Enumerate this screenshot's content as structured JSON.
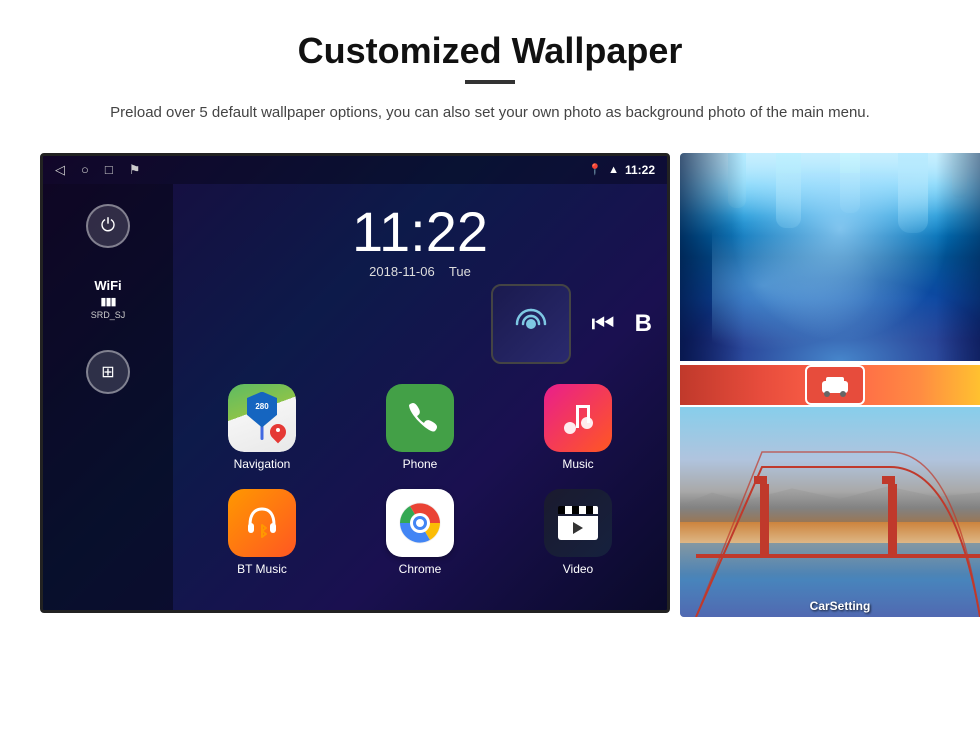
{
  "page": {
    "title": "Customized Wallpaper",
    "description": "Preload over 5 default wallpaper options, you can also set your own photo as background photo of the main menu."
  },
  "android": {
    "statusBar": {
      "time": "11:22",
      "navIcons": [
        "◁",
        "○",
        "□",
        "⚑"
      ],
      "rightIcons": [
        "📍",
        "WiFi",
        "11:22"
      ]
    },
    "clock": {
      "time": "11:22",
      "date": "2018-11-06",
      "day": "Tue"
    },
    "sidebar": {
      "powerLabel": "⏻",
      "wifi": {
        "label": "WiFi",
        "ssid": "SRD_SJ"
      },
      "appsLabel": "⊞"
    },
    "apps": [
      {
        "id": "navigation",
        "label": "Navigation",
        "icon": "navigation"
      },
      {
        "id": "phone",
        "label": "Phone",
        "icon": "phone"
      },
      {
        "id": "music",
        "label": "Music",
        "icon": "music"
      },
      {
        "id": "btmusic",
        "label": "BT Music",
        "icon": "btmusic"
      },
      {
        "id": "chrome",
        "label": "Chrome",
        "icon": "chrome"
      },
      {
        "id": "video",
        "label": "Video",
        "icon": "video"
      }
    ],
    "rightPanelApps": [
      {
        "id": "carsetting",
        "label": "CarSetting",
        "icon": "carsetting"
      }
    ]
  },
  "wallpapers": {
    "thumb1Alt": "Ice cave wallpaper",
    "thumb2Alt": "Golden Gate Bridge wallpaper",
    "stripLabel": "CarSetting"
  }
}
